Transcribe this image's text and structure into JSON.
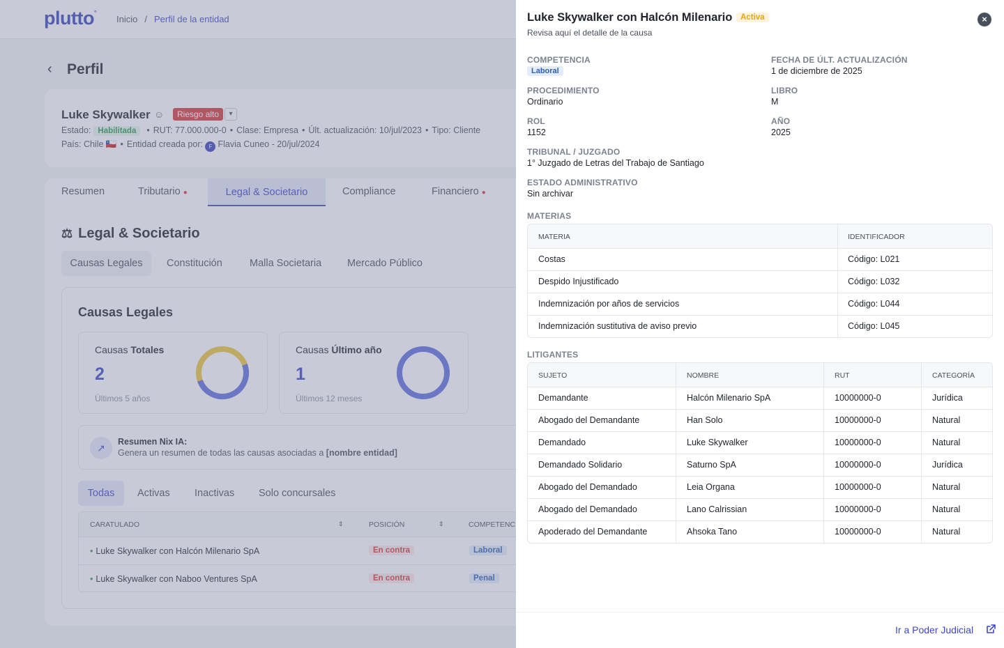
{
  "app": {
    "logo": "plutto",
    "logo_mark": "°"
  },
  "breadcrumb": {
    "home": "Inicio",
    "separator": "/",
    "current": "Perfil de la entidad"
  },
  "page": {
    "back_icon": "chevron-left-icon",
    "title": "Perfil"
  },
  "entity": {
    "name": "Luke Skywalker",
    "risk": "Riesgo alto",
    "estado_label": "Estado:",
    "estado_value": "Habilitada",
    "rut": "RUT: 77.000.000-0",
    "clase": "Clase: Empresa",
    "actualizacion": "Últ. actualización: 10/jul/2023",
    "tipo": "Tipo: Cliente",
    "pais": "País: Chile 🇨🇱",
    "creada_label": "Entidad creada por:",
    "creador_initial": "F",
    "creador": "Flavia Cuneo - 20/jul/2024"
  },
  "tabs": [
    "Resumen",
    "Tributario",
    "Legal & Societario",
    "Compliance",
    "Financiero"
  ],
  "section": {
    "title": "Legal & Societario",
    "subtabs": [
      "Causas Legales",
      "Constitución",
      "Malla Societaria",
      "Mercado Público"
    ]
  },
  "causas": {
    "title": "Causas Legales",
    "totales": {
      "label_a": "Causas ",
      "label_b": "Totales",
      "value": "2",
      "sub": "Últimos 5 años"
    },
    "ultimo": {
      "label_a": "Causas ",
      "label_b": "Último año",
      "value": "1",
      "sub": "Últimos 12 meses"
    },
    "nix_title": "Resumen Nix IA:",
    "nix_text_a": "Genera un resumen de todas las causas asociadas a ",
    "nix_text_b": "[nombre entidad]",
    "filters": [
      "Todas",
      "Activas",
      "Inactivas",
      "Solo concursales"
    ],
    "table_headers": [
      "CARATULADO",
      "POSICIÓN",
      "COMPETENCIA"
    ],
    "rows": [
      {
        "caratulado": "Luke Skywalker con Halcón Milenario SpA",
        "posicion": "En contra",
        "competencia": "Laboral"
      },
      {
        "caratulado": "Luke Skywalker con Naboo Ventures SpA",
        "posicion": "En contra",
        "competencia": "Penal"
      }
    ]
  },
  "panel": {
    "title": "Luke Skywalker con Halcón Milenario",
    "status": "Activa",
    "subtitle": "Revisa aquí el detalle de la causa",
    "fields": {
      "competencia_label": "COMPETENCIA",
      "competencia_value": "Laboral",
      "fecha_label": "FECHA DE ÚLT. ACTUALIZACIÓN",
      "fecha_value": "1 de diciembre de 2025",
      "procedimiento_label": "PROCEDIMIENTO",
      "procedimiento_value": "Ordinario",
      "libro_label": "LIBRO",
      "libro_value": "M",
      "rol_label": "ROL",
      "rol_value": "1152",
      "anio_label": "AÑO",
      "anio_value": "2025",
      "tribunal_label": "TRIBUNAL / JUZGADO",
      "tribunal_value": "1° Juzgado de Letras del Trabajo de Santiago",
      "estado_label": "ESTADO ADMINISTRATIVO",
      "estado_value": "Sin archivar"
    },
    "materias": {
      "label": "MATERIAS",
      "headers": [
        "MATERIA",
        "IDENTIFICADOR"
      ],
      "rows": [
        [
          "Costas",
          "Código: L021"
        ],
        [
          "Despido Injustificado",
          "Código: L032"
        ],
        [
          "Indemnización por años de servicios",
          "Código: L044"
        ],
        [
          "Indemnización sustitutiva de aviso previo",
          "Código: L045"
        ]
      ]
    },
    "litigantes": {
      "label": "LITIGANTES",
      "headers": [
        "SUJETO",
        "NOMBRE",
        "RUT",
        "CATEGORÍA"
      ],
      "rows": [
        [
          "Demandante",
          "Halcón Milenario SpA",
          "10000000-0",
          "Jurídica"
        ],
        [
          "Abogado del Demandante",
          "Han Solo",
          "10000000-0",
          "Natural"
        ],
        [
          "Demandado",
          "Luke Skywalker",
          "10000000-0",
          "Natural"
        ],
        [
          "Demandado Solidario",
          "Saturno SpA",
          "10000000-0",
          "Jurídica"
        ],
        [
          "Abogado del Demandado",
          "Leia Organa",
          "10000000-0",
          "Natural"
        ],
        [
          "Abogado del Demandado",
          "Lano Calrissian",
          "10000000-0",
          "Natural"
        ],
        [
          "Apoderado del Demandante",
          "Ahsoka Tano",
          "10000000-0",
          "Natural"
        ]
      ]
    },
    "footer_link": "Ir a Poder Judicial"
  }
}
